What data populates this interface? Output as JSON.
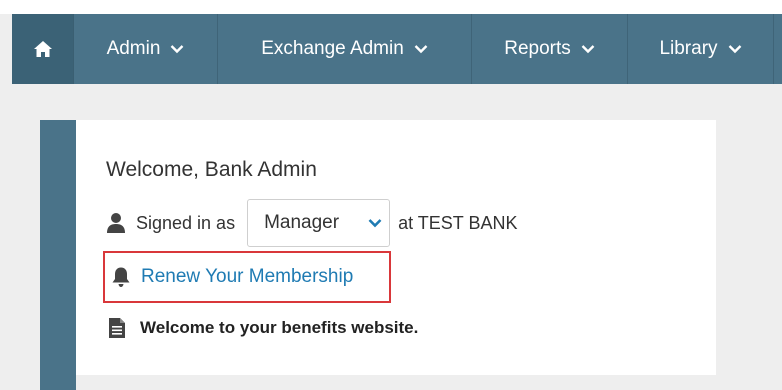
{
  "nav": {
    "home_icon": "home-icon",
    "items": [
      {
        "label": "Admin"
      },
      {
        "label": "Exchange Admin"
      },
      {
        "label": "Reports"
      },
      {
        "label": "Library"
      }
    ]
  },
  "card": {
    "welcome": "Welcome, Bank Admin",
    "signed_in_prefix": "Signed in as",
    "role": {
      "value": "Manager"
    },
    "bank_text": "at TEST BANK",
    "renew_link": "Renew Your Membership",
    "benefits_text": "Welcome to your benefits website."
  },
  "colors": {
    "nav_bg": "#4a7389",
    "nav_home_bg": "#3b6276",
    "link": "#1f7bb3",
    "highlight_border": "#d9373a"
  }
}
